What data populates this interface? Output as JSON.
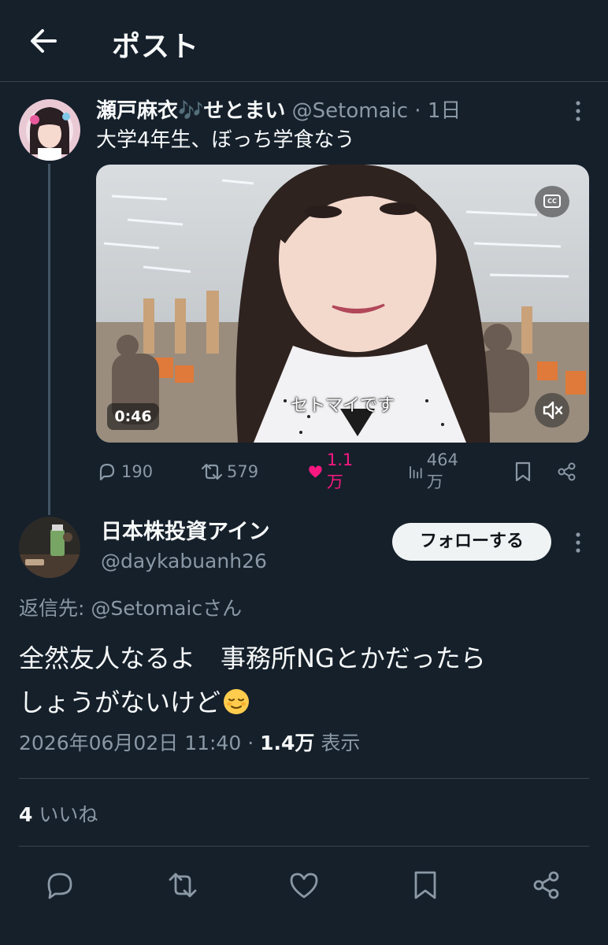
{
  "header": {
    "title": "ポスト",
    "back_icon": "arrow-left-icon"
  },
  "parent_tweet": {
    "display_name": "瀬戸麻衣🎶せとまい",
    "handle": "@Setomaic",
    "separator": "·",
    "time": "1日",
    "text": "大学4年生、ぼっち学食なう",
    "video": {
      "duration": "0:46",
      "subtitle": "セトマイです",
      "cc_label": "CC"
    },
    "stats": {
      "replies": "190",
      "reposts": "579",
      "likes": "1.1万",
      "views": "464万"
    },
    "like_color": "#f91880"
  },
  "main_tweet": {
    "display_name": "日本株投資アイン",
    "handle": "@daykabuanh26",
    "follow_label": "フォローする",
    "reply_to": "返信先: @Setomaicさん",
    "text_line1": "全然友人なるよ　事務所NGとかだったら",
    "text_line2": "しょうがないけど",
    "emoji": "😌",
    "timestamp": "2026年06月02日 11:40",
    "separator": "·",
    "views": "1.4万",
    "views_label": "表示",
    "likes_count": "4",
    "likes_label": "いいね"
  },
  "colors": {
    "background": "#15202b",
    "secondary_text": "#8b98a5",
    "divider": "#38444d"
  }
}
